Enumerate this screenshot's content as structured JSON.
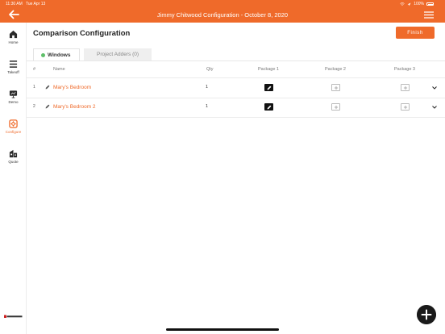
{
  "status": {
    "time": "11:30 AM",
    "date": "Tue Apr 13",
    "battery": "100%"
  },
  "header": {
    "title": "Jimmy Chitwood Configuration - October 8, 2020"
  },
  "sidebar": {
    "items": [
      {
        "label": "Home",
        "icon": "home-icon"
      },
      {
        "label": "Takeoff",
        "icon": "list-icon"
      },
      {
        "label": "Demo",
        "icon": "demo-icon"
      },
      {
        "label": "Configure",
        "icon": "configure-icon",
        "active": true
      },
      {
        "label": "Quote",
        "icon": "quote-icon"
      }
    ]
  },
  "page": {
    "title": "Comparison Configuration",
    "finish_label": "Finish"
  },
  "tabs": [
    {
      "label": "Windows",
      "active": true,
      "status_color": "#5fbf6a"
    },
    {
      "label": "Project Adders (0)",
      "active": false
    }
  ],
  "table": {
    "headers": [
      "#",
      "Name",
      "Qty",
      "Package 1",
      "Package 2",
      "Package 3"
    ],
    "rows": [
      {
        "num": "1",
        "name": "Mary's Bedroom",
        "qty": "1",
        "package1": "edit",
        "package2": "add",
        "package3": "add"
      },
      {
        "num": "2",
        "name": "Mary's Bedroom 2",
        "qty": "1",
        "package1": "edit",
        "package2": "add",
        "package3": "add"
      }
    ]
  },
  "colors": {
    "accent": "#ef6a2a",
    "success": "#5fbf6a"
  }
}
